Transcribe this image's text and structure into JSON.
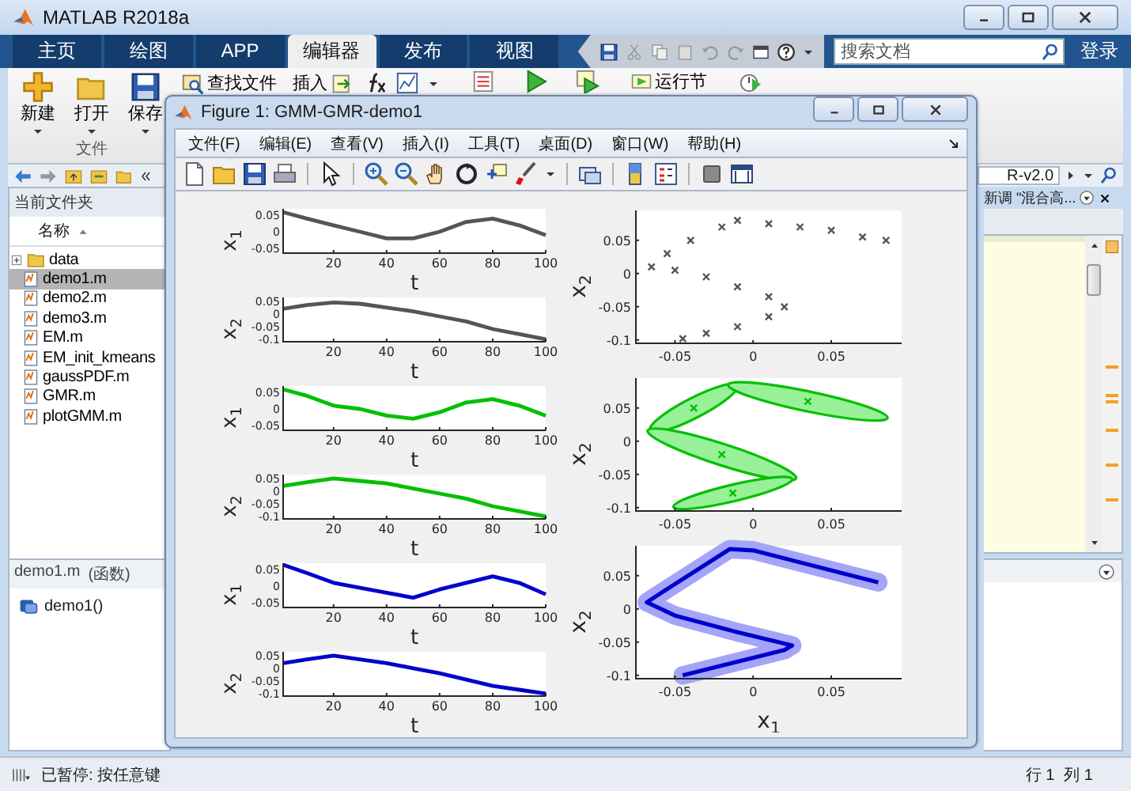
{
  "window": {
    "title": "MATLAB R2018a"
  },
  "tabs": [
    {
      "label": "主页",
      "selected": false
    },
    {
      "label": "绘图",
      "selected": false
    },
    {
      "label": "APP",
      "selected": false
    },
    {
      "label": "编辑器",
      "selected": true
    },
    {
      "label": "发布",
      "selected": false
    },
    {
      "label": "视图",
      "selected": false
    }
  ],
  "search": {
    "placeholder": "搜索文档"
  },
  "login": "登录",
  "ribbon": {
    "large_buttons": [
      {
        "kind": "new",
        "label": "新建"
      },
      {
        "kind": "open",
        "label": "打开"
      },
      {
        "kind": "save",
        "label": "保存"
      }
    ],
    "group_label": "文件",
    "find_files": "查找文件",
    "insert": "插入",
    "run_section": "运行节"
  },
  "path": {
    "value": "R-v2.0"
  },
  "file_browser": {
    "header": "当前文件夹",
    "column": "名称",
    "items": [
      {
        "kind": "folder",
        "name": "data",
        "selected": false
      },
      {
        "kind": "file",
        "name": "demo1.m",
        "selected": true
      },
      {
        "kind": "file",
        "name": "demo2.m",
        "selected": false
      },
      {
        "kind": "file",
        "name": "demo3.m",
        "selected": false
      },
      {
        "kind": "file",
        "name": "EM.m",
        "selected": false
      },
      {
        "kind": "file",
        "name": "EM_init_kmeans",
        "selected": false
      },
      {
        "kind": "file",
        "name": "gaussPDF.m",
        "selected": false
      },
      {
        "kind": "file",
        "name": "GMR.m",
        "selected": false
      },
      {
        "kind": "file",
        "name": "plotGMM.m",
        "selected": false
      }
    ]
  },
  "details": {
    "file": "demo1.m",
    "type": "(函数)",
    "function": "demo1()"
  },
  "editor": {
    "tab": "新调 \"混合高..."
  },
  "status": {
    "message": "已暂停: 按任意键",
    "line": "行 1",
    "column": "列 1"
  },
  "figure": {
    "title": "Figure 1: GMM-GMR-demo1",
    "menus": [
      "文件(F)",
      "编辑(E)",
      "查看(V)",
      "插入(I)",
      "工具(T)",
      "桌面(D)",
      "窗口(W)",
      "帮助(H)"
    ],
    "toolbar": [
      {
        "kind": "new"
      },
      {
        "kind": "open"
      },
      {
        "kind": "save"
      },
      {
        "kind": "print"
      },
      {
        "kind": "separator"
      },
      {
        "kind": "pointer"
      },
      {
        "kind": "separator"
      },
      {
        "kind": "zoom-in"
      },
      {
        "kind": "zoom-out"
      },
      {
        "kind": "pan"
      },
      {
        "kind": "rotate"
      },
      {
        "kind": "cursor"
      },
      {
        "kind": "brush"
      },
      {
        "kind": "separator"
      },
      {
        "kind": "link"
      },
      {
        "kind": "separator"
      },
      {
        "kind": "colorbar"
      },
      {
        "kind": "legend"
      },
      {
        "kind": "separator"
      },
      {
        "kind": "hide"
      },
      {
        "kind": "dock"
      }
    ],
    "time_charts": [
      {
        "chart_data": {
          "type": "line",
          "xlabel": "t",
          "ylabel": "x$_{1}$",
          "x": [
            1,
            10,
            20,
            30,
            40,
            50,
            60,
            70,
            80,
            90,
            100
          ],
          "xlim": [
            1,
            100
          ],
          "ylim": [
            -0.065,
            0.07
          ],
          "xticks": [
            20,
            40,
            60,
            80,
            100
          ],
          "yticks": [
            0.05,
            0,
            -0.05
          ],
          "series": [
            {
              "color": "#555555",
              "values": [
                0.06,
                0.04,
                0.02,
                0.0,
                -0.02,
                -0.02,
                0.0,
                0.03,
                0.04,
                0.02,
                -0.01
              ]
            }
          ]
        }
      },
      {
        "chart_data": {
          "type": "line",
          "xlabel": "t",
          "ylabel": "x$_{2}$",
          "x": [
            1,
            10,
            20,
            30,
            40,
            50,
            60,
            70,
            80,
            90,
            100
          ],
          "xlim": [
            1,
            100
          ],
          "ylim": [
            -0.11,
            0.065
          ],
          "xticks": [
            20,
            40,
            60,
            80,
            100
          ],
          "yticks": [
            0.05,
            0,
            -0.05,
            -0.1
          ],
          "series": [
            {
              "color": "#555555",
              "values": [
                0.02,
                0.035,
                0.045,
                0.04,
                0.025,
                0.01,
                -0.01,
                -0.03,
                -0.06,
                -0.08,
                -0.1
              ]
            }
          ]
        }
      },
      {
        "chart_data": {
          "type": "line",
          "xlabel": "t",
          "ylabel": "x$_{1}$",
          "x": [
            1,
            10,
            20,
            30,
            40,
            50,
            60,
            70,
            80,
            90,
            100
          ],
          "xlim": [
            1,
            100
          ],
          "ylim": [
            -0.065,
            0.07
          ],
          "xticks": [
            20,
            40,
            60,
            80,
            100
          ],
          "yticks": [
            0.05,
            0,
            -0.05
          ],
          "series": [
            {
              "color": "#00c000",
              "values": [
                0.06,
                0.04,
                0.01,
                0.0,
                -0.02,
                -0.03,
                -0.01,
                0.02,
                0.03,
                0.01,
                -0.02
              ]
            }
          ]
        }
      },
      {
        "chart_data": {
          "type": "line",
          "xlabel": "t",
          "ylabel": "x$_{2}$",
          "x": [
            1,
            10,
            20,
            30,
            40,
            50,
            60,
            70,
            80,
            90,
            100
          ],
          "xlim": [
            1,
            100
          ],
          "ylim": [
            -0.11,
            0.065
          ],
          "xticks": [
            20,
            40,
            60,
            80,
            100
          ],
          "yticks": [
            0.05,
            0,
            -0.05,
            -0.1
          ],
          "series": [
            {
              "color": "#00c000",
              "values": [
                0.02,
                0.035,
                0.05,
                0.04,
                0.03,
                0.01,
                -0.01,
                -0.03,
                -0.06,
                -0.08,
                -0.1
              ]
            }
          ]
        }
      },
      {
        "chart_data": {
          "type": "line",
          "xlabel": "t",
          "ylabel": "x$_{1}$",
          "x": [
            1,
            10,
            20,
            30,
            40,
            50,
            60,
            70,
            80,
            90,
            100
          ],
          "xlim": [
            1,
            100
          ],
          "ylim": [
            -0.065,
            0.07
          ],
          "xticks": [
            20,
            40,
            60,
            80,
            100
          ],
          "yticks": [
            0.05,
            0,
            -0.05
          ],
          "series": [
            {
              "color": "#0000cc",
              "values": [
                0.065,
                0.04,
                0.01,
                -0.005,
                -0.02,
                -0.035,
                -0.01,
                0.01,
                0.03,
                0.01,
                -0.025
              ]
            }
          ]
        }
      },
      {
        "chart_data": {
          "type": "line",
          "xlabel": "t",
          "ylabel": "x$_{2}$",
          "x": [
            1,
            10,
            20,
            30,
            40,
            50,
            60,
            70,
            80,
            90,
            100
          ],
          "xlim": [
            1,
            100
          ],
          "ylim": [
            -0.11,
            0.065
          ],
          "xticks": [
            20,
            40,
            60,
            80,
            100
          ],
          "yticks": [
            0.05,
            0,
            -0.05,
            -0.1
          ],
          "series": [
            {
              "color": "#0000cc",
              "values": [
                0.02,
                0.035,
                0.05,
                0.035,
                0.02,
                0.0,
                -0.02,
                -0.045,
                -0.07,
                -0.085,
                -0.1
              ]
            }
          ]
        }
      }
    ],
    "xy_charts": [
      {
        "chart_data": {
          "type": "scatter",
          "ylabel": "x$_{2}$",
          "x": [
            -0.045,
            -0.03,
            -0.01,
            0.01,
            0.02,
            0.01,
            -0.01,
            -0.03,
            -0.05,
            -0.065,
            -0.055,
            -0.04,
            -0.02,
            -0.01,
            0.01,
            0.03,
            0.05,
            0.07,
            0.085
          ],
          "xlim": [
            -0.075,
            0.095
          ],
          "ylim": [
            -0.105,
            0.095
          ],
          "xticks": [
            -0.05,
            0,
            0.05
          ],
          "yticks": [
            0.05,
            0,
            -0.05,
            -0.1
          ],
          "series": [
            {
              "color": "#555555",
              "values": [
                -0.098,
                -0.09,
                -0.08,
                -0.065,
                -0.05,
                -0.035,
                -0.02,
                -0.005,
                0.005,
                0.01,
                0.03,
                0.05,
                0.07,
                0.08,
                0.075,
                0.07,
                0.065,
                0.055,
                0.05
              ]
            }
          ]
        }
      },
      {
        "chart_data": {
          "type": "scatter",
          "ylabel": "x$_{2}$",
          "x": [
            -0.038,
            0.035,
            -0.02,
            -0.013
          ],
          "xlim": [
            -0.075,
            0.095
          ],
          "ylim": [
            -0.105,
            0.095
          ],
          "xticks": [
            -0.05,
            0,
            0.05
          ],
          "yticks": [
            0.05,
            0,
            -0.05,
            -0.1
          ],
          "series": [
            {
              "color": "#00c000",
              "values": [
                0.05,
                0.06,
                -0.02,
                -0.078
              ]
            }
          ]
        }
      },
      {
        "chart_data": {
          "type": "line",
          "xlabel": "x$_{1}$",
          "ylabel": "x$_{2}$",
          "x": [
            -0.045,
            0.02,
            0.025,
            -0.01,
            -0.05,
            -0.068,
            -0.055,
            -0.015,
            0.0,
            0.08
          ],
          "xlim": [
            -0.075,
            0.095
          ],
          "ylim": [
            -0.105,
            0.095
          ],
          "xticks": [
            -0.05,
            0,
            0.05
          ],
          "yticks": [
            0.05,
            0,
            -0.05,
            -0.1
          ],
          "series": [
            {
              "color": "#0000cc",
              "values": [
                -0.1,
                -0.062,
                -0.055,
                -0.035,
                -0.01,
                0.01,
                0.03,
                0.09,
                0.088,
                0.04
              ]
            }
          ]
        }
      }
    ]
  }
}
